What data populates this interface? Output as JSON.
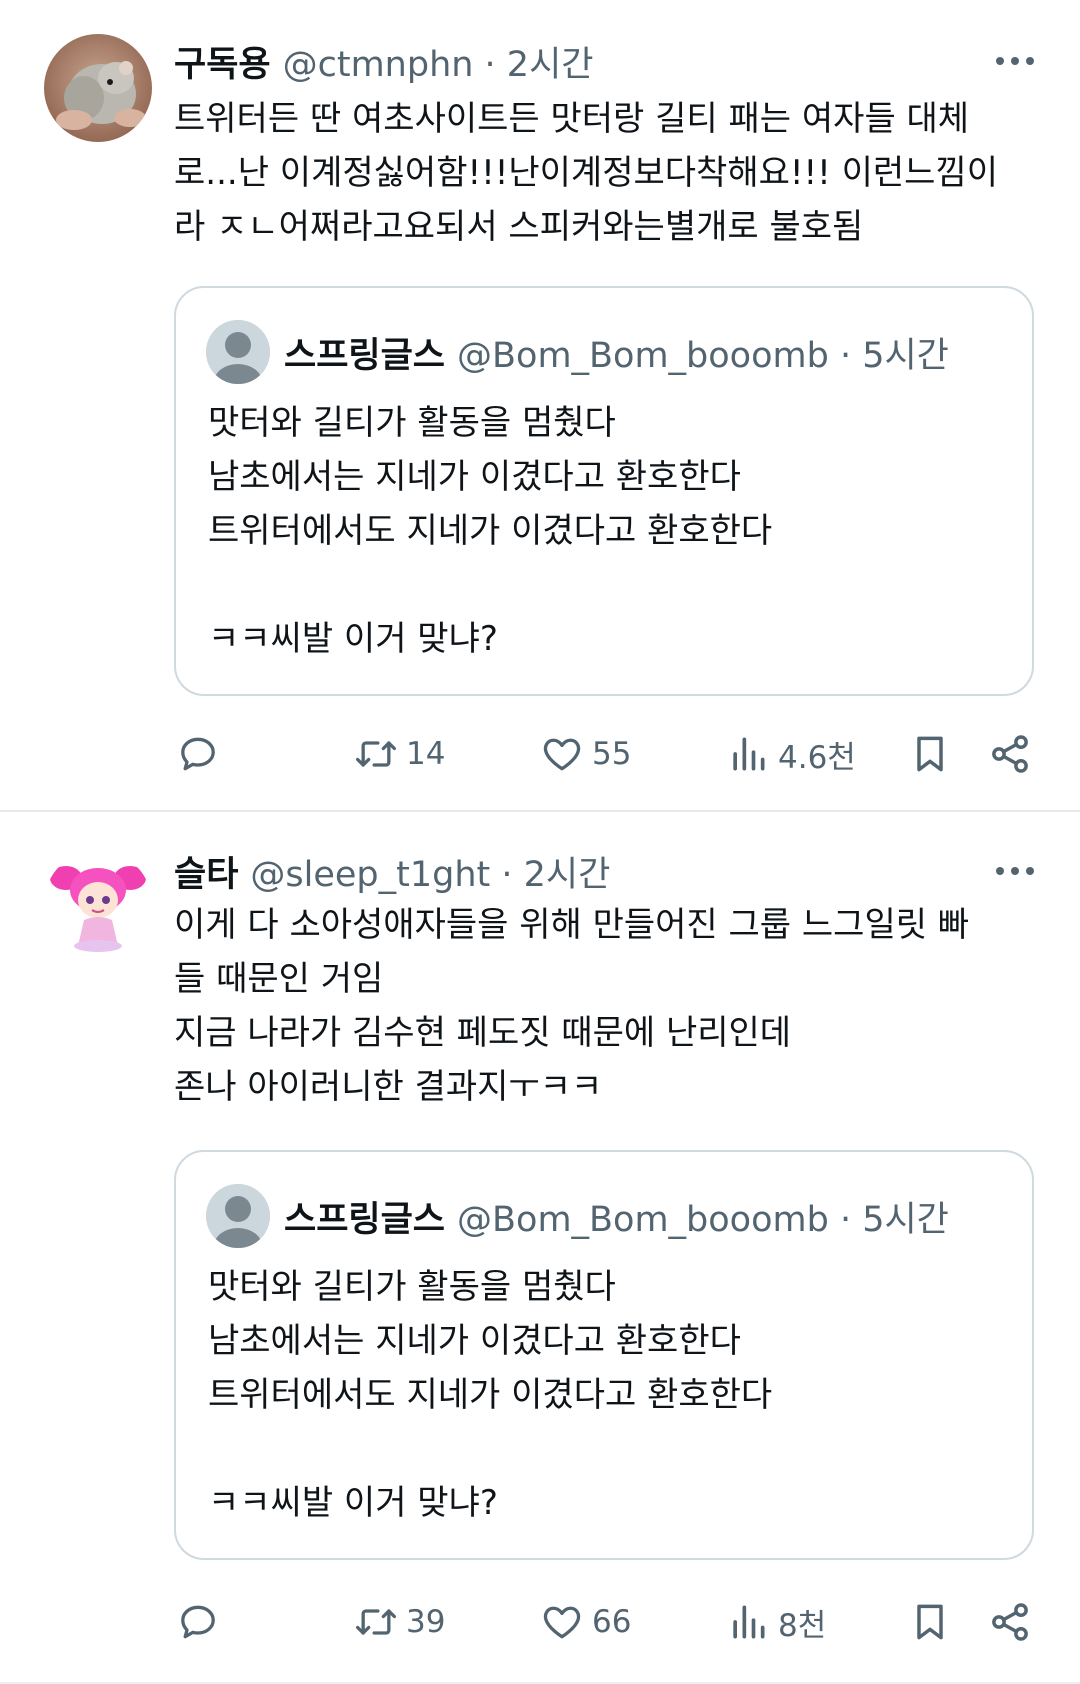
{
  "tweets": [
    {
      "name": "구독용",
      "meta": "@ctmnphn · 2시간",
      "more_icon": "more-horizontal-icon",
      "text_lines": [
        "트위터든 딴 여초사이트든 맛터랑 길티 패는 여자들 대체",
        "로...난 이계정싫어함!!!난이계정보다착해요!!! 이런느낌이",
        "라 ㅈㄴ어쩌라고요되서 스피커와는별개로 불호됨"
      ],
      "quote": {
        "name": "스프링글스",
        "meta": "@Bom_Bom_booomb · 5시간",
        "lines": [
          "맛터와 길티가 활동을 멈췄다",
          "남초에서는 지네가 이겼다고 환호한다",
          "트위터에서도 지네가 이겼다고 환호한다",
          "",
          "ㅋㅋ씨발 이거 맞냐?"
        ]
      },
      "actions": {
        "retweets": "14",
        "likes": "55",
        "views": "4.6천"
      }
    },
    {
      "name": "슬타",
      "meta": "@sleep_t1ght · 2시간",
      "more_icon": "more-horizontal-icon",
      "text_lines": [
        "이게 다 소아성애자들을 위해 만들어진 그룹 느그일릿 빠",
        "들 때문인 거임",
        "지금 나라가 김수현 페도짓 때문에 난리인데",
        "존나 아이러니한 결과지ㅜㅋㅋ"
      ],
      "quote": {
        "name": "스프링글스",
        "meta": "@Bom_Bom_booomb · 5시간",
        "lines": [
          "맛터와 길티가 활동을 멈췄다",
          "남초에서는 지네가 이겼다고 환호한다",
          "트위터에서도 지네가 이겼다고 환호한다",
          "",
          "ㅋㅋ씨발 이거 맞냐?"
        ]
      },
      "actions": {
        "retweets": "39",
        "likes": "66",
        "views": "8천"
      }
    }
  ],
  "icons": {
    "reply": "reply-icon",
    "retweet": "retweet-icon",
    "like": "heart-icon",
    "views": "views-icon",
    "bookmark": "bookmark-icon",
    "share": "share-icon"
  },
  "colors": {
    "text": "#0f1419",
    "secondary": "#536471",
    "border": "#cfd9de"
  }
}
